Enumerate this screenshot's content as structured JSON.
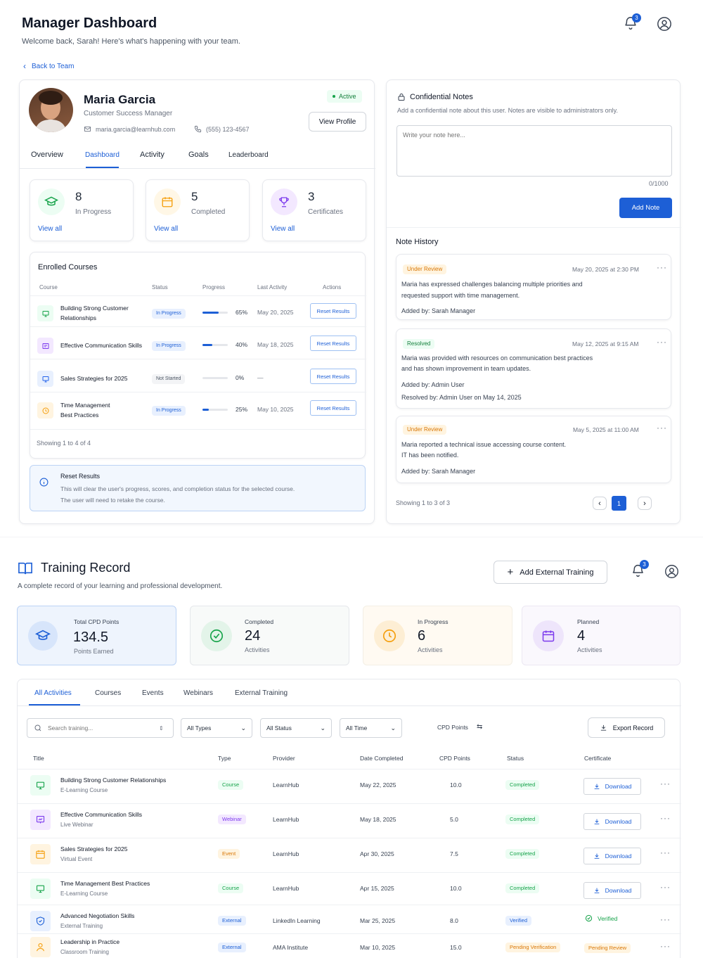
{
  "dashboard": {
    "title": "Manager Dashboard",
    "subtitle": "Welcome back, Sarah! Here's what's happening with your team.",
    "notif_count": "3",
    "back_label": "Back to Team"
  },
  "profile": {
    "name": "Maria Garcia",
    "role": "Customer Success Manager",
    "email": "maria.garcia@learnhub.com",
    "phone": "(555) 123-4567",
    "status": "Active",
    "view_profile": "View Profile",
    "tabs": [
      "Overview",
      "Dashboard",
      "Activity",
      "Goals",
      "Leaderboard"
    ],
    "active_tab": "Dashboard"
  },
  "stats": [
    {
      "value": "8",
      "label": "In Progress",
      "link": "View all",
      "icon": "graduation-cap-icon",
      "color": "#16a34a"
    },
    {
      "value": "5",
      "label": "Completed",
      "link": "View all",
      "icon": "calendar-icon",
      "color": "#f59e0b"
    },
    {
      "value": "3",
      "label": "Certificates",
      "link": "View all",
      "icon": "trophy-icon",
      "color": "#7c3aed"
    }
  ],
  "enrolled": {
    "title": "Enrolled Courses",
    "columns": [
      "Course",
      "Status",
      "Progress",
      "Last Activity",
      "Actions"
    ],
    "rows": [
      {
        "name": "Building Strong Customer Relationships",
        "line1": "Building Strong Customer",
        "line2": "Relationships",
        "status": "In Progress",
        "progress": 65,
        "progress_label": "65%",
        "last": "May 20, 2025",
        "action": "Reset Results",
        "color": "#16a34a"
      },
      {
        "name": "Effective Communication Skills",
        "line1": "Effective Communication Skills",
        "line2": "",
        "status": "In Progress",
        "progress": 40,
        "progress_label": "40%",
        "last": "May 18, 2025",
        "action": "Reset Results",
        "color": "#7c3aed"
      },
      {
        "name": "Sales Strategies for 2025",
        "line1": "Sales Strategies for 2025",
        "line2": "",
        "status": "Not Started",
        "progress": 0,
        "progress_label": "0%",
        "last": "—",
        "action": "Reset Results",
        "color": "#2563eb"
      },
      {
        "name": "Time Management Best Practices",
        "line1": "Time Management",
        "line2": "Best Practices",
        "status": "In Progress",
        "progress": 25,
        "progress_label": "25%",
        "last": "May 10, 2025",
        "action": "Reset Results",
        "color": "#f59e0b"
      }
    ],
    "showing": "Showing 1 to 4 of 4"
  },
  "reset_info": {
    "title": "Reset Results",
    "line1": "This will clear the user's progress, scores, and completion status for the selected course.",
    "line2": "The user will need to retake the course."
  },
  "notes": {
    "title": "Confidential Notes",
    "desc": "Add a confidential note about this user. Notes are visible to administrators only.",
    "placeholder": "Write your note here...",
    "counter": "0/1000",
    "add_btn": "Add Note",
    "history_title": "Note History",
    "items": [
      {
        "status": "Under Review",
        "date": "May 20, 2025 at 2:30 PM",
        "line1": "Maria has expressed challenges balancing multiple priorities and",
        "line2": "requested support with time management.",
        "added": "Added by: Sarah Manager",
        "resolved": ""
      },
      {
        "status": "Resolved",
        "date": "May 12, 2025 at 9:15 AM",
        "line1": "Maria was provided with resources on communication best practices",
        "line2": "and has shown improvement in team updates.",
        "added": "Added by: Admin User",
        "resolved": "Resolved by: Admin User on May 14, 2025"
      },
      {
        "status": "Under Review",
        "date": "May 5, 2025 at 11:00 AM",
        "line1": "Maria reported a technical issue accessing course content.",
        "line2": "IT has been notified.",
        "added": "Added by: Sarah Manager",
        "resolved": ""
      }
    ],
    "showing": "Showing 1 to 3 of 3",
    "page": "1"
  },
  "training": {
    "title": "Training Record",
    "subtitle": "A complete record of your learning and professional development.",
    "add_btn": "Add External Training",
    "notif_count": "3",
    "kpis": [
      {
        "label": "Total CPD Points",
        "value": "134.5",
        "sub": "Points Earned",
        "icon": "graduation-cap-icon"
      },
      {
        "label": "Completed",
        "value": "24",
        "sub": "Activities",
        "icon": "check-circle-icon"
      },
      {
        "label": "In Progress",
        "value": "6",
        "sub": "Activities",
        "icon": "clock-icon"
      },
      {
        "label": "Planned",
        "value": "4",
        "sub": "Activities",
        "icon": "calendar-icon"
      }
    ],
    "tabs": [
      "All Activities",
      "Courses",
      "Events",
      "Webinars",
      "External Training"
    ],
    "search_placeholder": "Search training...",
    "filters": [
      "All Types",
      "All Status",
      "All Time"
    ],
    "cpd_sort": "CPD Points",
    "export_btn": "Export Record",
    "columns": [
      "Title",
      "Type",
      "Provider",
      "Date Completed",
      "CPD Points",
      "Status",
      "Certificate"
    ],
    "rows": [
      {
        "title": "Building Strong Customer Relationships",
        "sub": "E-Learning Course",
        "type": "Course",
        "provider": "LearnHub",
        "date": "May 22, 2025",
        "points": "10.0",
        "status": "Completed",
        "cert": "Download",
        "icon": "monitor-icon"
      },
      {
        "title": "Effective Communication Skills",
        "sub": "Live Webinar",
        "type": "Webinar",
        "provider": "LearnHub",
        "date": "May 18, 2025",
        "points": "5.0",
        "status": "Completed",
        "cert": "Download",
        "icon": "presentation-icon"
      },
      {
        "title": "Sales Strategies for 2025",
        "sub": "Virtual Event",
        "type": "Event",
        "provider": "LearnHub",
        "date": "Apr 30, 2025",
        "points": "7.5",
        "status": "Completed",
        "cert": "Download",
        "icon": "calendar-icon"
      },
      {
        "title": "Time Management Best Practices",
        "sub": "E-Learning Course",
        "type": "Course",
        "provider": "LearnHub",
        "date": "Apr 15, 2025",
        "points": "10.0",
        "status": "Completed",
        "cert": "Download",
        "icon": "monitor-icon"
      },
      {
        "title": "Advanced Negotiation Skills",
        "sub": "External Training",
        "type": "External",
        "provider": "LinkedIn Learning",
        "date": "Mar 25, 2025",
        "points": "8.0",
        "status": "Verified",
        "cert": "Verified",
        "icon": "shield-icon"
      },
      {
        "title": "Leadership in Practice",
        "sub": "Classroom Training",
        "type": "External",
        "provider": "AMA Institute",
        "date": "Mar 10, 2025",
        "points": "15.0",
        "status": "Pending Verification",
        "cert": "Pending Review",
        "icon": "user-icon"
      }
    ]
  },
  "colors": {
    "accent": "#1d5fd6",
    "green": "#16a34a",
    "purple": "#7c3aed",
    "amber": "#f59e0b"
  }
}
